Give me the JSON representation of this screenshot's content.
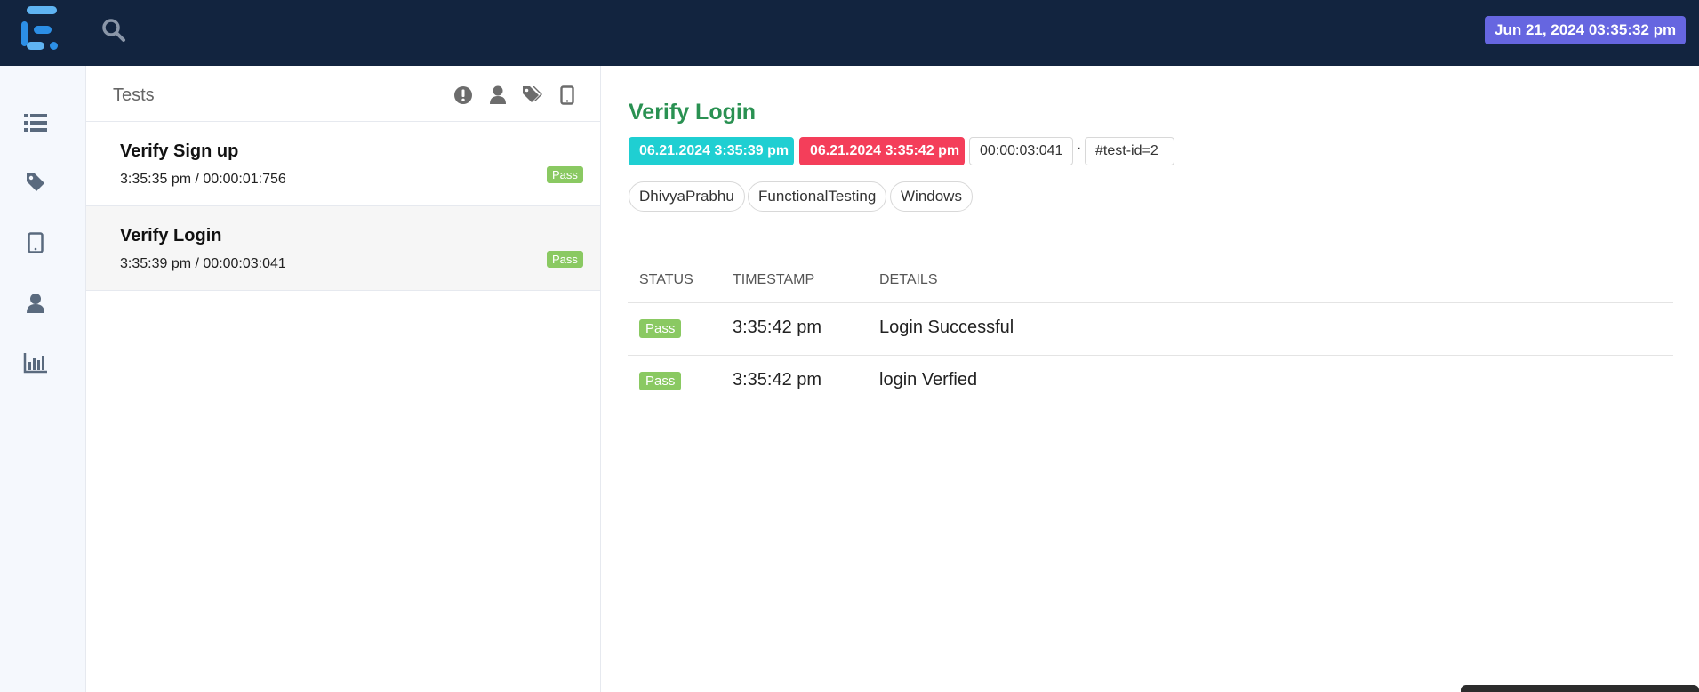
{
  "header": {
    "datetime": "Jun 21, 2024 03:35:32 pm",
    "brand_colors": [
      "#2c8fe6",
      "#5fb4f2",
      "#ffffff"
    ]
  },
  "sidebar": {
    "items": [
      {
        "icon": "list-icon"
      },
      {
        "icon": "tag-icon"
      },
      {
        "icon": "tablet-icon"
      },
      {
        "icon": "user-icon"
      },
      {
        "icon": "bar-chart-icon"
      }
    ]
  },
  "tests_panel": {
    "title": "Tests",
    "filters": [
      "exclamation-circle-icon",
      "user-icon",
      "tags-icon",
      "tablet-icon"
    ],
    "items": [
      {
        "name": "Verify Sign up",
        "time": "3:35:35 pm / 00:00:01:756",
        "status": "Pass"
      },
      {
        "name": "Verify Login",
        "time": "3:35:39 pm / 00:00:03:041",
        "status": "Pass"
      }
    ]
  },
  "detail": {
    "title": "Verify Login",
    "start": "06.21.2024 3:35:39 pm",
    "end": "06.21.2024 3:35:42 pm",
    "duration": "00:00:03:041",
    "separator": "·",
    "test_id": "#test-id=2",
    "tags": [
      "DhivyaPrabhu",
      "FunctionalTesting",
      "Windows"
    ],
    "columns": [
      "STATUS",
      "TIMESTAMP",
      "DETAILS"
    ],
    "rows": [
      {
        "status": "Pass",
        "timestamp": "3:35:42 pm",
        "details": "Login Successful"
      },
      {
        "status": "Pass",
        "timestamp": "3:35:42 pm",
        "details": "login Verfied"
      }
    ]
  },
  "colors": {
    "topbar": "#12243f",
    "date_badge": "#6666e0",
    "pass": "#8ac962",
    "start_chip": "#1fcfd2",
    "end_chip": "#f43e5a",
    "title_green": "#2a9152"
  }
}
